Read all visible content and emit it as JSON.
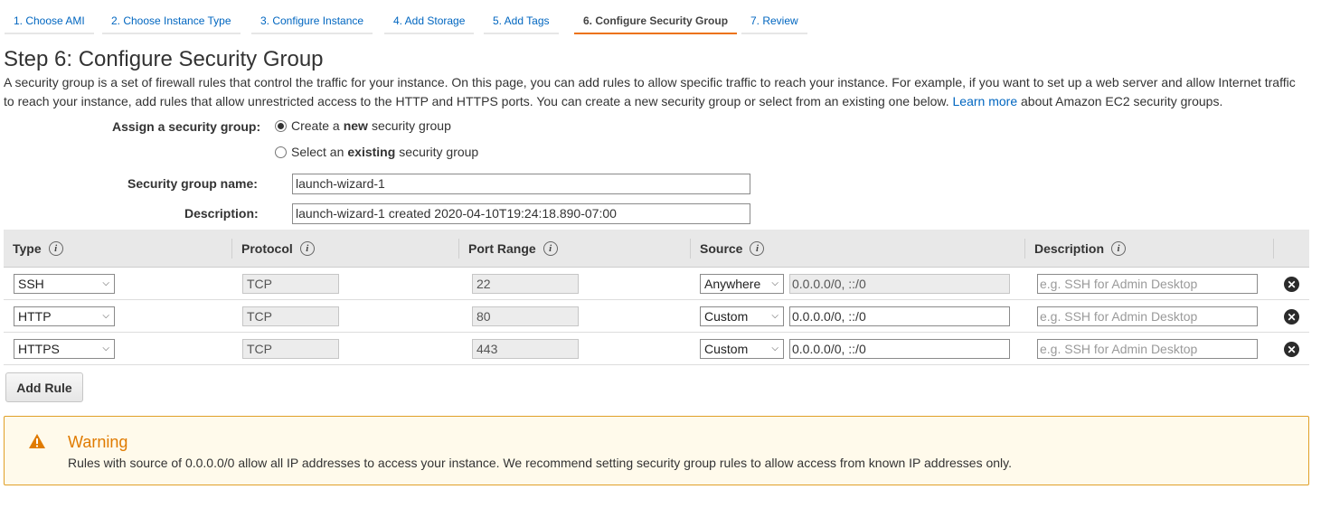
{
  "steps": [
    {
      "label": "1. Choose AMI"
    },
    {
      "label": "2. Choose Instance Type"
    },
    {
      "label": "3. Configure Instance"
    },
    {
      "label": "4. Add Storage"
    },
    {
      "label": "5. Add Tags"
    },
    {
      "label": "6. Configure Security Group"
    },
    {
      "label": "7. Review"
    }
  ],
  "active_step": 6,
  "page_title": "Step 6: Configure Security Group",
  "intro": {
    "text": "A security group is a set of firewall rules that control the traffic for your instance. On this page, you can add rules to allow specific traffic to reach your instance. For example, if you want to set up a web server and allow Internet traffic to reach your instance, add rules that allow unrestricted access to the HTTP and HTTPS ports. You can create a new security group or select from an existing one below.",
    "link": "Learn more",
    "suffix": "about Amazon EC2 security groups."
  },
  "assign": {
    "label": "Assign a security group:",
    "option_new": {
      "pre": "Create a",
      "bold": "new",
      "post": "security group",
      "selected": true
    },
    "option_existing": {
      "pre": "Select an",
      "bold": "existing",
      "post": "security group",
      "selected": false
    }
  },
  "group_name": {
    "label": "Security group name:",
    "value": "launch-wizard-1"
  },
  "description": {
    "label": "Description:",
    "value": "launch-wizard-1 created 2020-04-10T19:24:18.890-07:00"
  },
  "table": {
    "headers": {
      "type": "Type",
      "protocol": "Protocol",
      "port_range": "Port Range",
      "source": "Source",
      "description": "Description"
    },
    "info_glyph": "i",
    "remove_glyph": "✕",
    "dropdown_glyph": "⌵",
    "rules": [
      {
        "type": "SSH",
        "protocol": "TCP",
        "port": "22",
        "source_mode": "Anywhere",
        "source": "0.0.0.0/0, ::/0",
        "description_placeholder": "e.g. SSH for Admin Desktop"
      },
      {
        "type": "HTTP",
        "protocol": "TCP",
        "port": "80",
        "source_mode": "Custom",
        "source": "0.0.0.0/0, ::/0",
        "description_placeholder": "e.g. SSH for Admin Desktop"
      },
      {
        "type": "HTTPS",
        "protocol": "TCP",
        "port": "443",
        "source_mode": "Custom",
        "source": "0.0.0.0/0, ::/0",
        "description_placeholder": "e.g. SSH for Admin Desktop"
      }
    ]
  },
  "add_rule_label": "Add Rule",
  "warning": {
    "title": "Warning",
    "text": "Rules with source of 0.0.0.0/0 allow all IP addresses to access your instance. We recommend setting security group rules to allow access from known IP addresses only."
  },
  "colors": {
    "accent": "#ec7211",
    "link": "#0066c0",
    "warning": "#e07b00"
  }
}
